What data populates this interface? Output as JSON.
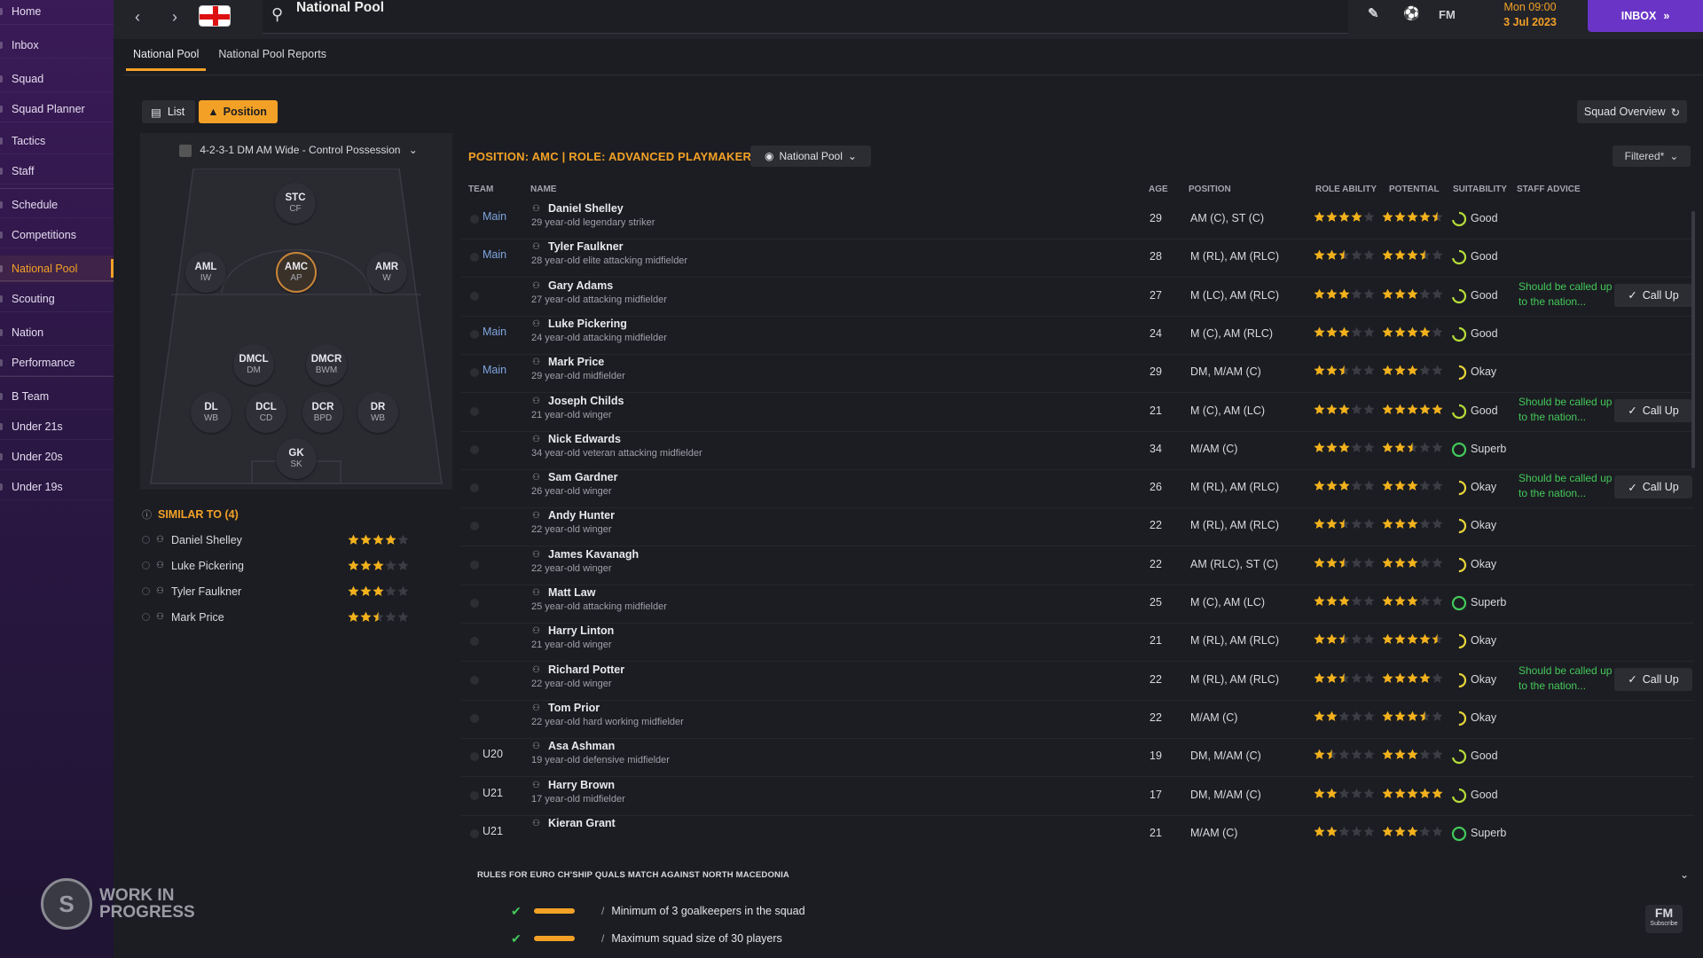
{
  "sidebar": {
    "items": [
      "Home",
      "Inbox",
      "Squad",
      "Squad Planner",
      "Tactics",
      "Staff",
      "Schedule",
      "Competitions",
      "National Pool",
      "Scouting",
      "Nation",
      "Performance",
      "B Team",
      "Under 21s",
      "Under 20s",
      "Under 19s"
    ],
    "active": "National Pool"
  },
  "watermark": {
    "line1": "WORK IN",
    "line2": "PROGRESS"
  },
  "topbar": {
    "title": "National Pool",
    "fm_label": "FM",
    "date_line1": "Mon 09:00",
    "date_line2": "3 Jul 2023",
    "inbox_label": "INBOX"
  },
  "tabs": [
    "National Pool",
    "National Pool Reports"
  ],
  "view": {
    "list_label": "List",
    "position_label": "Position",
    "squad_overview_label": "Squad Overview"
  },
  "formation": {
    "label": "4-2-3-1 DM AM Wide - Control Possession",
    "positions": [
      {
        "pos": "STC",
        "role": "CF"
      },
      {
        "pos": "AML",
        "role": "IW"
      },
      {
        "pos": "AMC",
        "role": "AP",
        "selected": true
      },
      {
        "pos": "AMR",
        "role": "W"
      },
      {
        "pos": "DMCL",
        "role": "DM"
      },
      {
        "pos": "DMCR",
        "role": "BWM"
      },
      {
        "pos": "DL",
        "role": "WB"
      },
      {
        "pos": "DCL",
        "role": "CD"
      },
      {
        "pos": "DCR",
        "role": "BPD"
      },
      {
        "pos": "DR",
        "role": "WB"
      },
      {
        "pos": "GK",
        "role": "SK"
      }
    ]
  },
  "similar": {
    "title": "SIMILAR TO (4)",
    "players": [
      {
        "name": "Daniel Shelley",
        "stars": 4
      },
      {
        "name": "Luke Pickering",
        "stars": 3
      },
      {
        "name": "Tyler Faulkner",
        "stars": 3
      },
      {
        "name": "Mark Price",
        "stars": 2.5
      }
    ]
  },
  "table": {
    "position_title": "POSITION: AMC | ROLE: ADVANCED PLAYMAKER",
    "pool_dropdown": "National Pool",
    "filter_label": "Filtered*",
    "columns": {
      "team": "TEAM",
      "name": "NAME",
      "age": "AGE",
      "position": "POSITION",
      "role_ability": "ROLE ABILITY",
      "potential": "POTENTIAL",
      "suitability": "SUITABILITY",
      "staff_advice": "STAFF ADVICE"
    },
    "call_up_label": "Call Up",
    "rows": [
      {
        "team": "Main",
        "name": "Daniel Shelley",
        "desc": "29 year-old legendary striker",
        "age": "29",
        "position": "AM (C), ST (C)",
        "ra": 4,
        "pot": 4.5,
        "suit": "Good",
        "advice": "",
        "call": false
      },
      {
        "team": "Main",
        "name": "Tyler Faulkner",
        "desc": "28 year-old elite attacking midfielder",
        "age": "28",
        "position": "M (RL), AM (RLC)",
        "ra": 2.5,
        "pot": 3.5,
        "suit": "Good",
        "advice": "",
        "call": false
      },
      {
        "team": "",
        "name": "Gary Adams",
        "desc": "27 year-old attacking midfielder",
        "age": "27",
        "position": "M (LC), AM (RLC)",
        "ra": 3,
        "pot": 3,
        "suit": "Good",
        "advice": "Should be called up to the nation...",
        "call": true
      },
      {
        "team": "Main",
        "name": "Luke Pickering",
        "desc": "24 year-old attacking midfielder",
        "age": "24",
        "position": "M (C), AM (RLC)",
        "ra": 3,
        "pot": 4,
        "suit": "Good",
        "advice": "",
        "call": false
      },
      {
        "team": "Main",
        "name": "Mark Price",
        "desc": "29 year-old midfielder",
        "age": "29",
        "position": "DM, M/AM (C)",
        "ra": 2.5,
        "pot": 3,
        "suit": "Okay",
        "advice": "",
        "call": false
      },
      {
        "team": "",
        "name": "Joseph Childs",
        "desc": "21 year-old winger",
        "age": "21",
        "position": "M (C), AM (LC)",
        "ra": 3,
        "pot": 5,
        "suit": "Good",
        "advice": "Should be called up to the nation...",
        "call": true
      },
      {
        "team": "",
        "name": "Nick Edwards",
        "desc": "34 year-old veteran attacking midfielder",
        "age": "34",
        "position": "M/AM (C)",
        "ra": 3,
        "pot": 2.5,
        "suit": "Superb",
        "advice": "",
        "call": false
      },
      {
        "team": "",
        "name": "Sam Gardner",
        "desc": "26 year-old winger",
        "age": "26",
        "position": "M (RL), AM (RLC)",
        "ra": 3,
        "pot": 3,
        "suit": "Okay",
        "advice": "Should be called up to the nation...",
        "call": true
      },
      {
        "team": "",
        "name": "Andy Hunter",
        "desc": "22 year-old winger",
        "age": "22",
        "position": "M (RL), AM (RLC)",
        "ra": 2.5,
        "pot": 3,
        "suit": "Okay",
        "advice": "",
        "call": false
      },
      {
        "team": "",
        "name": "James Kavanagh",
        "desc": "22 year-old winger",
        "age": "22",
        "position": "AM (RLC), ST (C)",
        "ra": 2.5,
        "pot": 3,
        "suit": "Okay",
        "advice": "",
        "call": false
      },
      {
        "team": "",
        "name": "Matt Law",
        "desc": "25 year-old attacking midfielder",
        "age": "25",
        "position": "M (C), AM (LC)",
        "ra": 3,
        "pot": 3,
        "suit": "Superb",
        "advice": "",
        "call": false
      },
      {
        "team": "",
        "name": "Harry Linton",
        "desc": "21 year-old winger",
        "age": "21",
        "position": "M (RL), AM (RLC)",
        "ra": 2.5,
        "pot": 4.5,
        "suit": "Okay",
        "advice": "",
        "call": false
      },
      {
        "team": "",
        "name": "Richard Potter",
        "desc": "22 year-old winger",
        "age": "22",
        "position": "M (RL), AM (RLC)",
        "ra": 2.5,
        "pot": 4,
        "suit": "Okay",
        "advice": "Should be called up to the nation...",
        "call": true
      },
      {
        "team": "",
        "name": "Tom Prior",
        "desc": "22 year-old hard working midfielder",
        "age": "22",
        "position": "M/AM (C)",
        "ra": 2,
        "pot": 3.5,
        "suit": "Okay",
        "advice": "",
        "call": false
      },
      {
        "team": "U20",
        "name": "Asa Ashman",
        "desc": "19 year-old defensive midfielder",
        "age": "19",
        "position": "DM, M/AM (C)",
        "ra": 1.5,
        "pot": 3,
        "suit": "Good",
        "advice": "",
        "call": false
      },
      {
        "team": "U21",
        "name": "Harry Brown",
        "desc": "17 year-old midfielder",
        "age": "17",
        "position": "DM, M/AM (C)",
        "ra": 2,
        "pot": 5,
        "suit": "Good",
        "advice": "",
        "call": false
      },
      {
        "team": "U21",
        "name": "Kieran Grant",
        "desc": "",
        "age": "21",
        "position": "M/AM (C)",
        "ra": 2,
        "pot": 3,
        "suit": "Superb",
        "advice": "",
        "call": false
      }
    ]
  },
  "rules": {
    "title": "RULES FOR EURO CH'SHIP QUALS MATCH AGAINST NORTH MACEDONIA",
    "items": [
      "Minimum of 3 goalkeepers in the squad",
      "Maximum squad size of 30 players"
    ]
  },
  "badge": {
    "main": "FM",
    "sub": "Subscribe"
  },
  "colors": {
    "accent": "#f3a126",
    "sidebar": "#2b1744",
    "inbox": "#6a35c7",
    "good_green": "#43c95a",
    "team_blue": "#7ea5e0"
  }
}
